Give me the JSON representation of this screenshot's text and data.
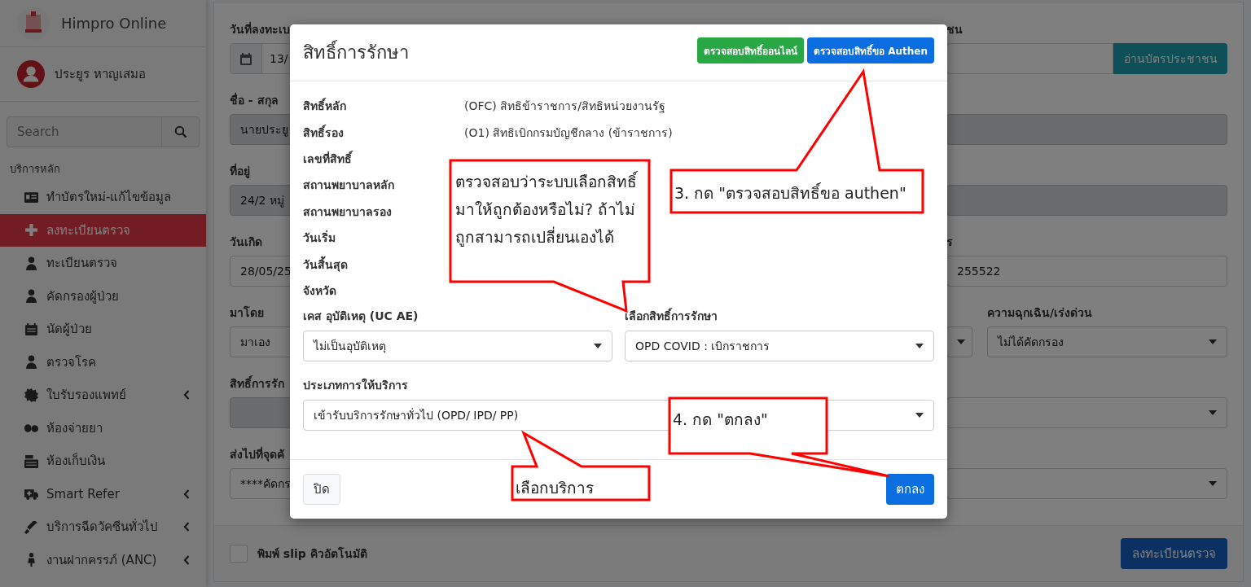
{
  "app": {
    "name": "Himpro Online"
  },
  "user": {
    "name": "ประยูร หาญเสมอ"
  },
  "sidebar": {
    "search": {
      "placeholder": "Search"
    },
    "section": "บริการหลัก",
    "items": [
      {
        "label": "ทำบัตรใหม่-แก้ไขข้อมูล",
        "selected": false,
        "expandable": false
      },
      {
        "label": "ลงทะเบียนตรวจ",
        "selected": true,
        "expandable": false
      },
      {
        "label": "ทะเบียนตรวจ",
        "selected": false,
        "expandable": false
      },
      {
        "label": "คัดกรองผู้ป่วย",
        "selected": false,
        "expandable": false
      },
      {
        "label": "นัดผู้ป่วย",
        "selected": false,
        "expandable": false
      },
      {
        "label": "ตรวจโรค",
        "selected": false,
        "expandable": false
      },
      {
        "label": "ใบรับรองแพทย์",
        "selected": false,
        "expandable": true
      },
      {
        "label": "ห้องจ่ายยา",
        "selected": false,
        "expandable": false
      },
      {
        "label": "ห้องเก็บเงิน",
        "selected": false,
        "expandable": false
      },
      {
        "label": "Smart Refer",
        "selected": false,
        "expandable": true
      },
      {
        "label": "บริการฉีดวัคซีนทั่วไป",
        "selected": false,
        "expandable": true
      },
      {
        "label": "งานฝากครรภ์ (ANC)",
        "selected": false,
        "expandable": true
      }
    ]
  },
  "form": {
    "left": [
      {
        "label": "วันที่ลงทะเบ",
        "kind": "date",
        "value": "13/"
      },
      {
        "label": "ชื่อ - สกุล",
        "kind": "input",
        "disabled": true,
        "value": "นายประยู"
      },
      {
        "label": "ที่อยู่",
        "kind": "input",
        "disabled": true,
        "value": "24/2 หมู่"
      },
      {
        "label": "วันเกิด",
        "kind": "input",
        "disabled": false,
        "value": "28/05/25"
      },
      {
        "label": "มาโดย",
        "kind": "select",
        "value": "มาเอง"
      },
      {
        "label": "สิทธิ์การรัก",
        "kind": "input",
        "disabled": true
      },
      {
        "label": "ส่งไปที่จุดคั",
        "kind": "select",
        "value": "****คัดกร"
      }
    ],
    "right": [
      [
        {
          "label": "ชน",
          "kind": "reader",
          "button": "อ่านบัตรประชาชน"
        }
      ],
      [
        {
          "kind": "input",
          "disabled": true
        }
      ],
      [
        {
          "kind": "input",
          "disabled": true
        }
      ],
      [
        {
          "label": "ร",
          "kind": "input",
          "disabled": false,
          "value": "255522"
        }
      ],
      [
        {
          "kind": "select"
        },
        {
          "label": "ความฉุกเฉิน/เร่งด่วน",
          "kind": "select",
          "value": "ไม่ได้คัดกรอง"
        }
      ],
      [
        {
          "kind": "select"
        }
      ],
      [
        {
          "kind": "select"
        }
      ]
    ],
    "print_slip": {
      "label": "พิมพ์ slip คิวอัตโนมัติ",
      "checked": false
    },
    "submit": "ลงทะเบียนตรวจ"
  },
  "dialog": {
    "title": "สิทธิ์การรักษา",
    "actions": [
      {
        "label": "ตรวจสอบสิทธิ์ออนไลน์",
        "kind": "success"
      },
      {
        "label": "ตรวจสอบสิทธิ์ขอ Authen",
        "kind": "primary"
      }
    ],
    "info": [
      {
        "label": "สิทธิ์หลัก",
        "value": "(OFC) สิทธิข้าราชการ/สิทธิหน่วยงานรัฐ"
      },
      {
        "label": "สิทธิ์รอง",
        "value": "(O1) สิทธิเบิกกรมบัญชีกลาง (ข้าราชการ)"
      },
      {
        "label": "เลขที่สิทธิ์"
      },
      {
        "label": "สถานพยาบาลหลัก"
      },
      {
        "label": "สถานพยาบาลรอง"
      },
      {
        "label": "วันเริ่ม"
      },
      {
        "label": "วันสิ้นสุด"
      },
      {
        "label": "จังหวัด"
      }
    ],
    "selects": [
      {
        "label": "เคส อุบัติเหตุ (UC AE)",
        "value": "ไม่เป็นอุบัติเหตุ"
      },
      {
        "label": "เลือกสิทธิ์การรักษา",
        "value": "OPD COVID : เบิกราชการ"
      }
    ],
    "service": {
      "label": "ประเภทการให้บริการ",
      "value": "เข้ารับบริการรักษาทั่วไป (OPD/ IPD/ PP)"
    },
    "buttons": [
      {
        "label": "ปิด",
        "kind": "secondary"
      },
      {
        "label": "ตกลง",
        "kind": "primary"
      }
    ]
  },
  "callouts": [
    {
      "lines": [
        "ตรวจสอบว่าระบบเลือกสิทธิ์",
        "มาให้ถูกต้องหรือไม่? ถ้าไม่",
        "ถูกสามารถเปลี่ยนเองได้"
      ]
    },
    {
      "lines": [
        "3. กด \"ตรวจสอบสิทธิ์ขอ authen\""
      ]
    },
    {
      "lines": [
        "4. กด \"ตกลง\""
      ]
    },
    {
      "lines": [
        "เลือกบริการ"
      ]
    }
  ]
}
